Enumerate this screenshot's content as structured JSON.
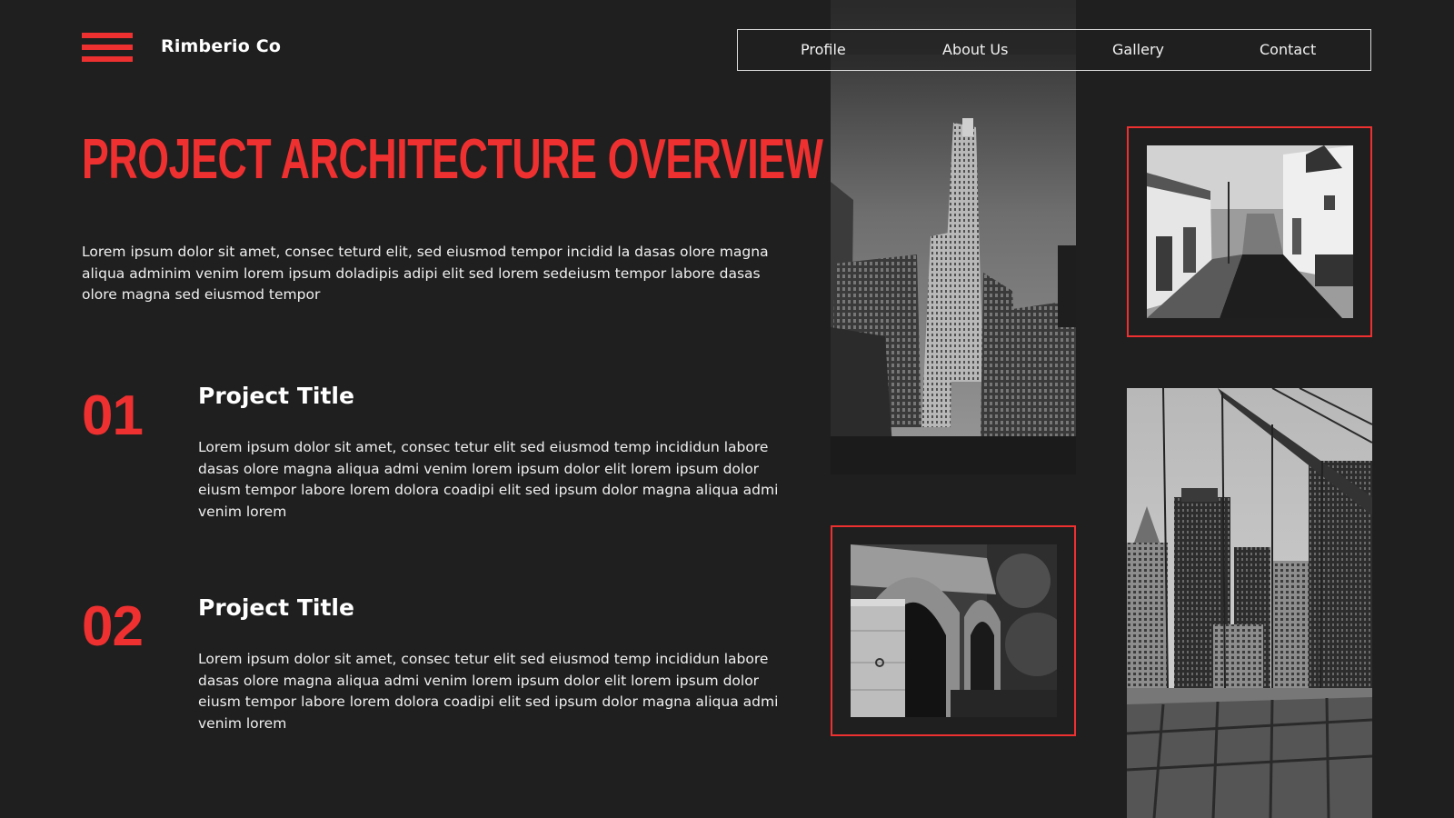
{
  "theme": {
    "accent": "#ee3030",
    "background": "#1f1f1f"
  },
  "header": {
    "menu_icon": "hamburger-menu-icon",
    "brand": "Rimberio Co",
    "nav": [
      "Profile",
      "About Us",
      "Gallery",
      "Contact"
    ]
  },
  "hero": {
    "title": "Project Architecture Overview",
    "intro": "Lorem ipsum dolor sit amet, consec teturd elit, sed eiusmod tempor incidid la dasas olore magna aliqua adminim venim lorem ipsum doladipis adipi elit sed lorem sedeiusm tempor labore dasas olore magna sed eiusmod tempor"
  },
  "projects": [
    {
      "number": "01",
      "title": "Project Title",
      "body": "Lorem ipsum dolor sit amet, consec tetur elit sed eiusmod temp incididun labore dasas olore magna aliqua admi venim lorem ipsum dolor elit  lorem ipsum dolor eiusm tempor labore lorem dolora coadipi elit sed ipsum dolor magna aliqua admi venim lorem"
    },
    {
      "number": "02",
      "title": "Project Title",
      "body": "Lorem ipsum dolor sit amet, consec tetur elit sed eiusmod temp incididun labore dasas olore magna aliqua admi venim lorem ipsum dolor elit lorem ipsum dolor eiusm tempor labore lorem dolora coadipi elit sed ipsum dolor magna aliqua admi venim lorem"
    }
  ],
  "gallery": [
    {
      "subject": "skyscraper"
    },
    {
      "subject": "street"
    },
    {
      "subject": "stone-bridge"
    },
    {
      "subject": "suspension-bridge"
    }
  ]
}
